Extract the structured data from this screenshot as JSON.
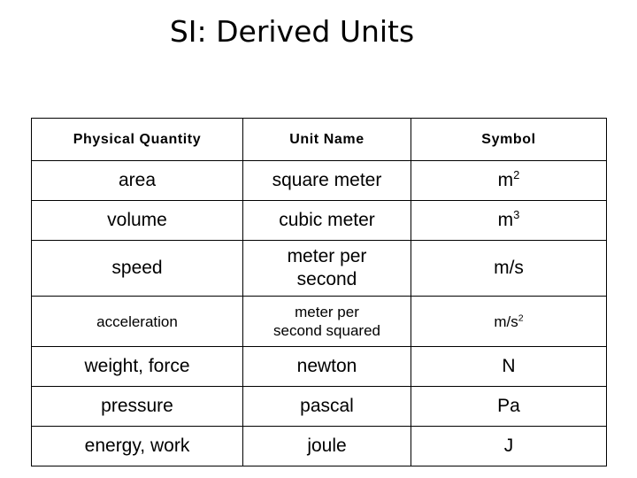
{
  "slide": {
    "title": "SI: Derived Units",
    "background_color": "#ffffff",
    "text_color": "#000000",
    "border_color": "#000000"
  },
  "table": {
    "headers": {
      "quantity": "Physical Quantity",
      "unit_name": "Unit Name",
      "symbol": "Symbol"
    },
    "rows": [
      {
        "quantity": "area",
        "unit_line1": "square meter",
        "unit_line2": "",
        "symbol_base": "m",
        "symbol_sup": "2",
        "symbol_plain": ""
      },
      {
        "quantity": "volume",
        "unit_line1": "cubic meter",
        "unit_line2": "",
        "symbol_base": "m",
        "symbol_sup": "3",
        "symbol_plain": ""
      },
      {
        "quantity": "speed",
        "unit_line1": "meter per",
        "unit_line2": "second",
        "symbol_base": "",
        "symbol_sup": "",
        "symbol_plain": "m/s"
      },
      {
        "quantity": "acceleration",
        "unit_line1": "meter per",
        "unit_line2": "second squared",
        "symbol_base": "m/s",
        "symbol_sup": "2",
        "symbol_plain": ""
      },
      {
        "quantity": "weight, force",
        "unit_line1": "newton",
        "unit_line2": "",
        "symbol_base": "",
        "symbol_sup": "",
        "symbol_plain": "N"
      },
      {
        "quantity": "pressure",
        "unit_line1": "pascal",
        "unit_line2": "",
        "symbol_base": "",
        "symbol_sup": "",
        "symbol_plain": "Pa"
      },
      {
        "quantity": "energy, work",
        "unit_line1": "joule",
        "unit_line2": "",
        "symbol_base": "",
        "symbol_sup": "",
        "symbol_plain": "J"
      }
    ]
  }
}
